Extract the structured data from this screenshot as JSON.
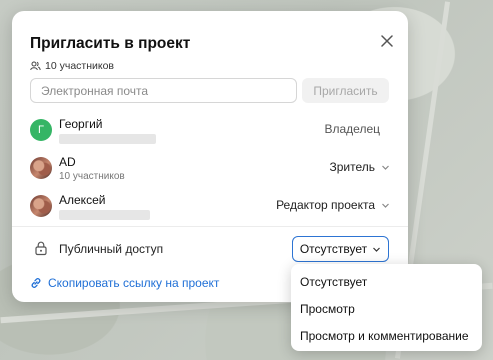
{
  "dialog": {
    "title": "Пригласить в проект",
    "members_count": "10 участников",
    "email_placeholder": "Электронная почта",
    "invite_label": "Пригласить"
  },
  "members": [
    {
      "name": "Георгий",
      "initial": "Г",
      "subtitle": "",
      "role": "Владелец"
    },
    {
      "name": "AD",
      "initial": "",
      "subtitle": "10 участников",
      "role": "Зритель"
    },
    {
      "name": "Алексей",
      "initial": "",
      "subtitle": "",
      "role": "Редактор проекта"
    }
  ],
  "public_access": {
    "label": "Публичный доступ",
    "selected": "Отсутствует",
    "options": [
      "Отсутствует",
      "Просмотр",
      "Просмотр и комментирование"
    ]
  },
  "copy_link_label": "Скопировать ссылку на проект",
  "colors": {
    "accent": "#2d74d3",
    "link": "#1f6fd6",
    "avatar_green": "#35b565"
  }
}
